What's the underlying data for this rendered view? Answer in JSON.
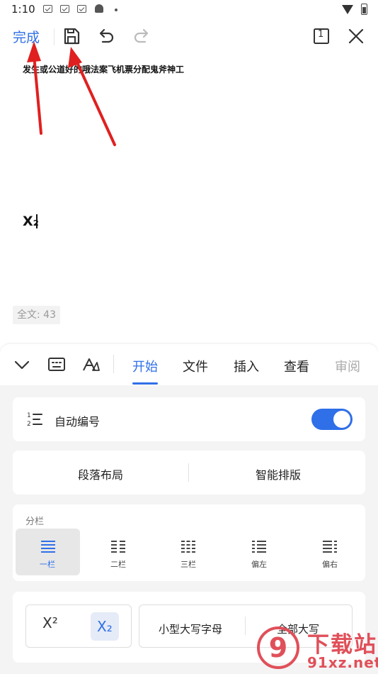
{
  "status_bar": {
    "time": "1:10"
  },
  "toolbar": {
    "done_label": "完成",
    "page_badge": "1"
  },
  "document": {
    "line1": "发生或公道好的哦法案飞机票分配鬼斧神工",
    "line2": "X₂"
  },
  "word_count": "全文: 43",
  "panel": {
    "tabs": [
      "开始",
      "文件",
      "插入",
      "查看",
      "审阅"
    ],
    "active_tab": "开始",
    "auto_number": {
      "label": "自动编号",
      "enabled": true
    },
    "layout": {
      "paragraph": "段落布局",
      "smart": "智能排版"
    },
    "columns": {
      "title": "分栏",
      "options": [
        "一栏",
        "二栏",
        "三栏",
        "偏左",
        "偏右"
      ],
      "selected": "一栏"
    },
    "case": {
      "superscript": "X²",
      "subscript": "X₂",
      "small_caps": "小型大写字母",
      "all_caps": "全部大写"
    }
  },
  "watermark": {
    "text1": "下载站",
    "text2": "91xz.net",
    "logo": "9"
  },
  "colors": {
    "accent": "#2f6fe8",
    "arrow": "#e02020",
    "watermark": "#e0505a"
  }
}
